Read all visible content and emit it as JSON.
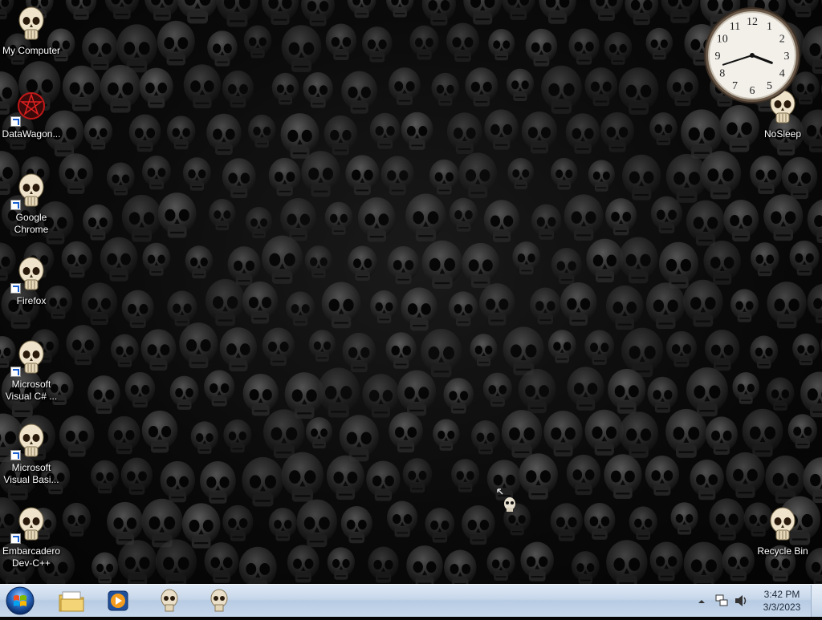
{
  "desktop": {
    "icons_left": [
      {
        "label": "My Computer",
        "shortcut": false
      },
      {
        "label": "DataWagon...",
        "shortcut": true,
        "icon": "datawagon-icon"
      },
      {
        "label": "Google Chrome",
        "shortcut": true
      },
      {
        "label": "Firefox",
        "shortcut": true
      },
      {
        "label": "Microsoft Visual C# ...",
        "shortcut": true
      },
      {
        "label": "Microsoft Visual Basi...",
        "shortcut": true
      },
      {
        "label": "Embarcadero Dev-C++",
        "shortcut": true
      }
    ],
    "icons_right": [
      {
        "label": "NoSleep",
        "shortcut": false
      },
      {
        "label": "Recycle Bin",
        "shortcut": false
      }
    ]
  },
  "clock_gadget": {
    "numerals": [
      "12",
      "1",
      "2",
      "3",
      "4",
      "5",
      "6",
      "7",
      "8",
      "9",
      "10",
      "11"
    ],
    "hour": 3,
    "minute": 42
  },
  "taskbar": {
    "start_button": "windows-logo-icon",
    "pinned": [
      "folder-icon",
      "media-player-icon",
      "skull-icon",
      "skull-icon"
    ],
    "tray": {
      "icons": [
        "show-hidden-icons-arrow",
        "network-icon",
        "volume-icon"
      ],
      "time": "3:42 PM",
      "date": "3/3/2023"
    }
  },
  "colors": {
    "taskbar_top": "#dfe9f5",
    "taskbar_bottom": "#b7cbe3",
    "wallpaper": "#0a0a0a"
  }
}
